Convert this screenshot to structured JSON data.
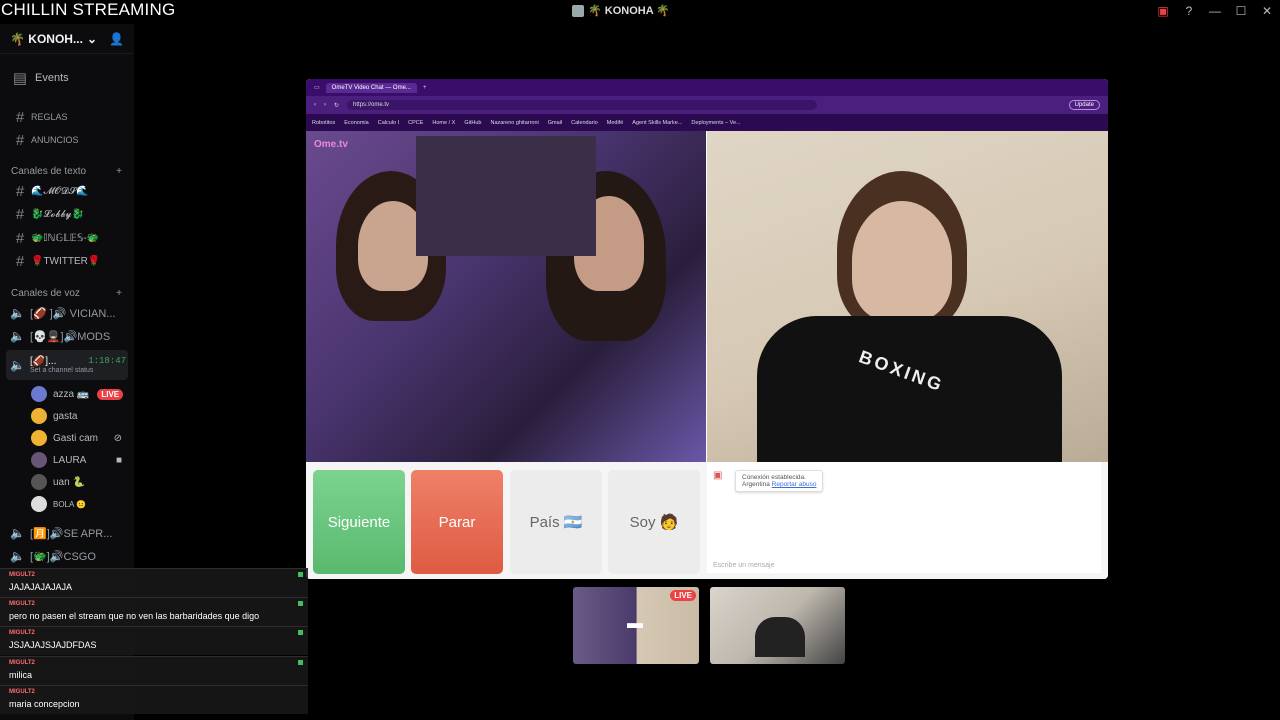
{
  "window": {
    "stream_title": "CHILLIN STREAMING",
    "server_title": "🌴 KONOHA 🌴"
  },
  "server": {
    "name": "🌴 KONOH..."
  },
  "sidebar": {
    "events_label": "Events",
    "channels": [
      {
        "label": "REGLAS"
      },
      {
        "label": "ANUNCIOS"
      }
    ],
    "text_category": "Canales de texto",
    "text_channels": [
      {
        "label": "🌊𝓜𝓞𝓓𝓢🌊"
      },
      {
        "label": "🐉𝓛𝓸𝓫𝓫𝔂🐉"
      },
      {
        "label": "🐲𝕀ℕ𝔾𝕃𝔼𝕊-🐲"
      },
      {
        "label": "🌹TWITTER🌹"
      }
    ],
    "voice_category": "Canales de voz",
    "voice_channels": [
      {
        "label": "[🏈 ]🔊 VICIAN..."
      },
      {
        "label": "[💀💂🏻‍♂️]🔊MODS"
      },
      {
        "label": "[🏈]...",
        "timer": "1:18:47",
        "status": "Set a channel status"
      }
    ],
    "members": [
      {
        "name": "azza 🚌",
        "badge": "LIVE",
        "color": "#6a7ad0"
      },
      {
        "name": "gasta",
        "color": "#f0b232"
      },
      {
        "name": "Gasti cam",
        "color": "#f0b232"
      },
      {
        "name": "LAURA",
        "color": "#665577"
      },
      {
        "name": "uan 🐍",
        "color": "#555"
      },
      {
        "name": "BOLA 😐",
        "color": "#ddd"
      }
    ],
    "more_voice": [
      {
        "label": "[🈷️]🔊SE APR..."
      },
      {
        "label": "[🐲]🔊CSGO"
      }
    ]
  },
  "browser": {
    "tab_title": "OmeTV Video Chat — Ome...",
    "url": "https://ome.tv",
    "update_label": "Update",
    "bookmarks": [
      "Robotitos",
      "Economia",
      "Calculo I",
      "CPCE",
      "Home / X",
      "GitHub",
      "Nazareno ghitarroni",
      "Gmail",
      "Calendario",
      "Medifé",
      "Agent Skills Marke...",
      "Deployments – Ve..."
    ]
  },
  "ometv": {
    "logo": "Ome.tv",
    "next_label": "Siguiente",
    "stop_label": "Parar",
    "country_label": "País 🇦🇷",
    "soy_label": "Soy 🧑",
    "connection_text": "Conexión establecida.",
    "country_text": "Argentina",
    "report_label": "Reportar abuso",
    "input_placeholder": "Escribe un mensaje",
    "shirt_text": "BOXING"
  },
  "thumbnails": {
    "live_label": "LIVE"
  },
  "chat": {
    "messages": [
      {
        "user": "MIGULT2",
        "text": "JAJAJAJAJAJA"
      },
      {
        "user": "MIGULT2",
        "text": "pero no pasen el stream que no ven las barbaridades que digo"
      },
      {
        "user": "MIGULT2",
        "text": "JSJAJAJSJAJDFDAS"
      },
      {
        "user": "MIGULT2",
        "text": "milica"
      },
      {
        "user": "MIGULT2",
        "text": "maria concepcion"
      }
    ]
  },
  "colors": {
    "live_red": "#ed4245",
    "next_green": "#58b96e",
    "stop_red": "#de5b43",
    "browser_purple": "#4a1f7e"
  }
}
